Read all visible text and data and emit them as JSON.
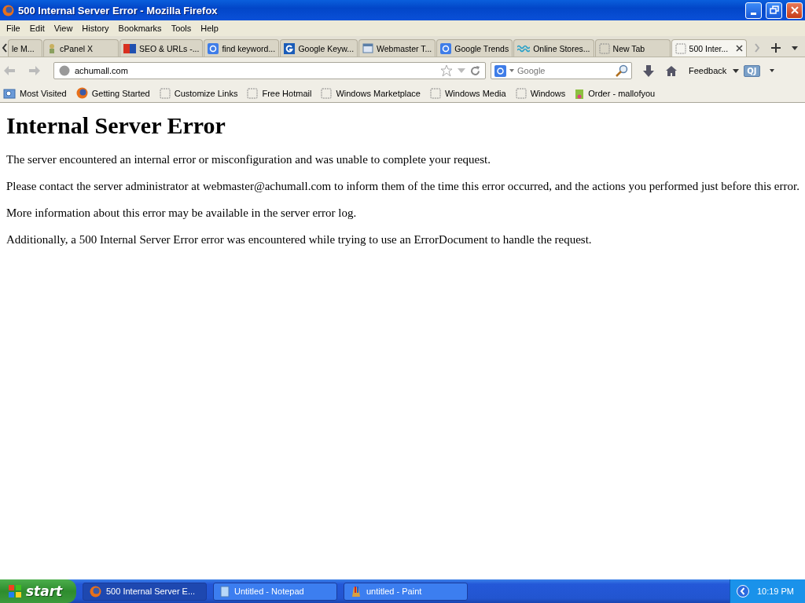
{
  "window": {
    "title": "500 Internal Server Error - Mozilla Firefox"
  },
  "menu": [
    "File",
    "Edit",
    "View",
    "History",
    "Bookmarks",
    "Tools",
    "Help"
  ],
  "tabs": [
    {
      "label": "le M...",
      "kind": "none",
      "selected": false
    },
    {
      "label": "cPanel X",
      "kind": "cpanel",
      "selected": false
    },
    {
      "label": "SEO & URLs -...",
      "kind": "am",
      "selected": false
    },
    {
      "label": "find keyword...",
      "kind": "google",
      "selected": false
    },
    {
      "label": "Google Keyw...",
      "kind": "gblue",
      "selected": false
    },
    {
      "label": "Webmaster T...",
      "kind": "webmaster",
      "selected": false
    },
    {
      "label": "Google Trends",
      "kind": "google",
      "selected": false
    },
    {
      "label": "Online Stores...",
      "kind": "waves",
      "selected": false
    },
    {
      "label": "New Tab",
      "kind": "blank",
      "selected": false
    },
    {
      "label": "500 Inter...",
      "kind": "blank",
      "selected": true
    }
  ],
  "address": {
    "value": "achumall.com"
  },
  "search": {
    "placeholder": "Google"
  },
  "toolbar": {
    "feedback": "Feedback",
    "addon": "QJ"
  },
  "bookmarks": [
    {
      "label": "Most Visited",
      "kind": "folder"
    },
    {
      "label": "Getting Started",
      "kind": "firefox"
    },
    {
      "label": "Customize Links",
      "kind": "blank"
    },
    {
      "label": "Free Hotmail",
      "kind": "blank"
    },
    {
      "label": "Windows Marketplace",
      "kind": "blank"
    },
    {
      "label": "Windows Media",
      "kind": "blank"
    },
    {
      "label": "Windows",
      "kind": "blank"
    },
    {
      "label": "Order - mallofyou",
      "kind": "bag"
    }
  ],
  "page": {
    "heading": "Internal Server Error",
    "paragraphs": [
      "The server encountered an internal error or misconfiguration and was unable to complete your request.",
      "Please contact the server administrator at webmaster@achumall.com to inform them of the time this error occurred, and the actions you performed just before this error.",
      "More information about this error may be available in the server error log.",
      "Additionally, a 500 Internal Server Error error was encountered while trying to use an ErrorDocument to handle the request."
    ]
  },
  "taskbar": {
    "start": "start",
    "items": [
      {
        "label": "500 Internal Server E...",
        "kind": "firefox",
        "selected": true
      },
      {
        "label": "Untitled - Notepad",
        "kind": "notepad",
        "selected": false
      },
      {
        "label": "untitled - Paint",
        "kind": "paint",
        "selected": false
      }
    ],
    "clock": "10:19 PM"
  }
}
